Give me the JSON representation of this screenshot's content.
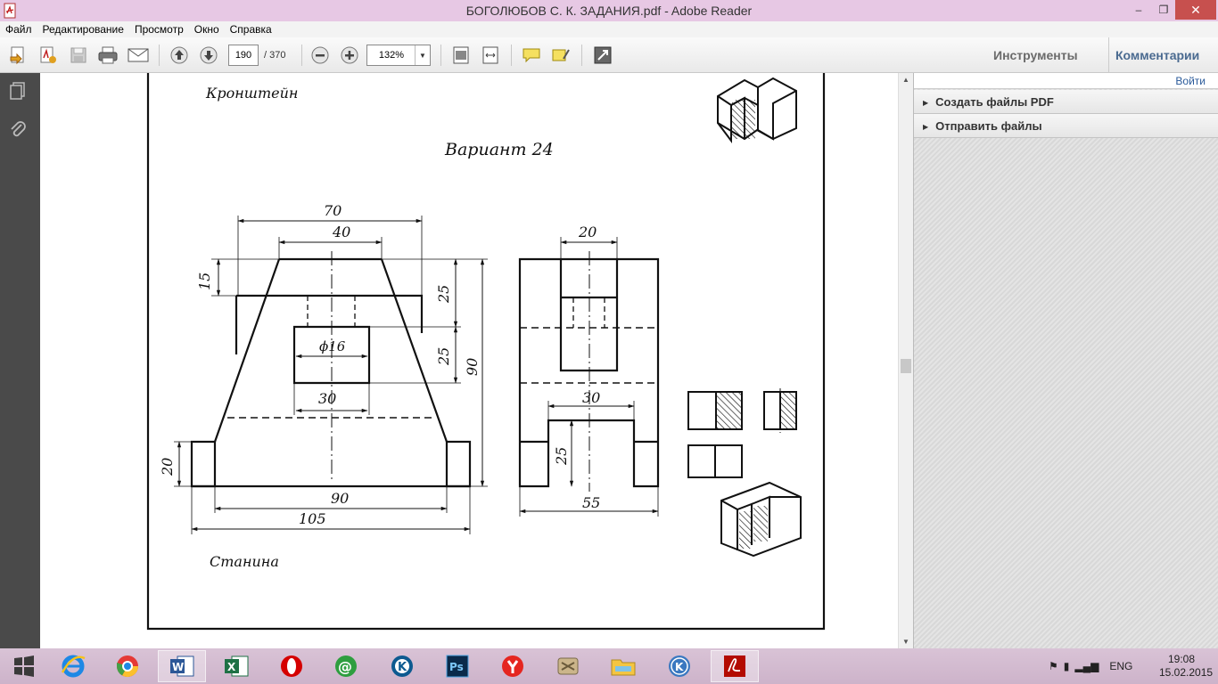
{
  "window": {
    "title": "БОГОЛЮБОВ С. К. ЗАДАНИЯ.pdf - Adobe Reader",
    "min": "–",
    "max": "❐",
    "close": "✕"
  },
  "menu": [
    "Файл",
    "Редактирование",
    "Просмотр",
    "Окно",
    "Справка"
  ],
  "toolbar": {
    "page_current": "190",
    "page_total": "/ 370",
    "zoom": "132%",
    "tools_label": "Инструменты",
    "comments_label": "Комментарии"
  },
  "right_panel": {
    "login": "Войти",
    "items": [
      "Создать файлы PDF",
      "Отправить файлы"
    ]
  },
  "document": {
    "heading_top": "Кронштейн",
    "variant": "Вариант 24",
    "caption_bottom": "Станина",
    "front_dims": {
      "w70": "70",
      "w40": "40",
      "h15": "15",
      "h25a": "25",
      "h25b": "25",
      "h90": "90",
      "phi16": "ϕ16",
      "w30": "30",
      "h20": "20",
      "w90": "90",
      "w105": "105"
    },
    "side_dims": {
      "w20": "20",
      "w30": "30",
      "h25": "25",
      "w55": "55"
    }
  },
  "taskbar": {
    "apps": [
      "start",
      "ie",
      "chrome",
      "word",
      "excel",
      "opera",
      "icq",
      "kaspersky",
      "photoshop",
      "yandex",
      "archive",
      "explorer",
      "k-app",
      "adobe-reader"
    ],
    "lang": "ENG",
    "time": "19:08",
    "date": "15.02.2015"
  }
}
